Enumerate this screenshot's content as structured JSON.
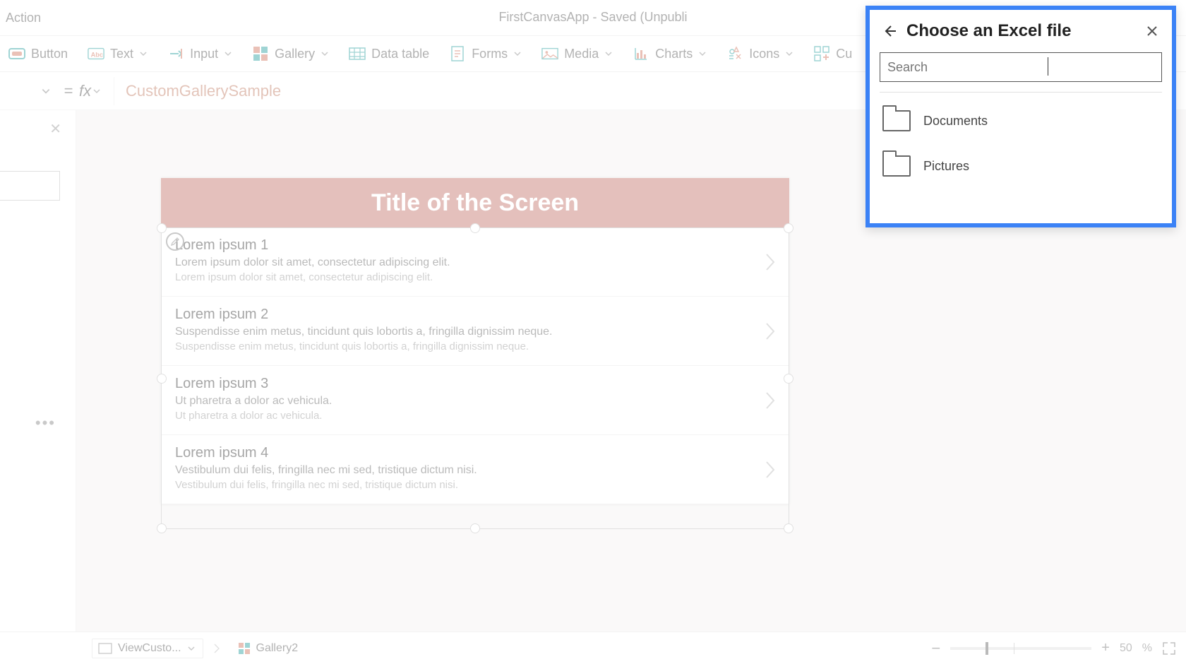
{
  "header": {
    "menu_action": "Action",
    "app_title": "FirstCanvasApp - Saved (Unpubli"
  },
  "ribbon": {
    "button": "Button",
    "text": "Text",
    "input": "Input",
    "gallery": "Gallery",
    "data_table": "Data table",
    "forms": "Forms",
    "media": "Media",
    "charts": "Charts",
    "icons": "Icons",
    "custom": "Cu"
  },
  "formula": {
    "value": "CustomGallerySample"
  },
  "screen": {
    "title": "Title of the Screen",
    "items": [
      {
        "title": "Lorem ipsum 1",
        "sub1": "Lorem ipsum dolor sit amet, consectetur adipiscing elit.",
        "sub2": "Lorem ipsum dolor sit amet, consectetur adipiscing elit."
      },
      {
        "title": "Lorem ipsum 2",
        "sub1": "Suspendisse enim metus, tincidunt quis lobortis a, fringilla dignissim neque.",
        "sub2": "Suspendisse enim metus, tincidunt quis lobortis a, fringilla dignissim neque."
      },
      {
        "title": "Lorem ipsum 3",
        "sub1": "Ut pharetra a dolor ac vehicula.",
        "sub2": "Ut pharetra a dolor ac vehicula."
      },
      {
        "title": "Lorem ipsum 4",
        "sub1": "Vestibulum dui felis, fringilla nec mi sed, tristique dictum nisi.",
        "sub2": "Vestibulum dui felis, fringilla nec mi sed, tristique dictum nisi."
      }
    ]
  },
  "status": {
    "screen_ctrl": "ViewCusto...",
    "gallery_ctrl": "Gallery2",
    "zoom_value": "50",
    "zoom_suffix": "%"
  },
  "panel": {
    "title": "Choose an Excel file",
    "search_placeholder": "Search",
    "items": [
      {
        "label": "Documents"
      },
      {
        "label": "Pictures"
      }
    ]
  }
}
